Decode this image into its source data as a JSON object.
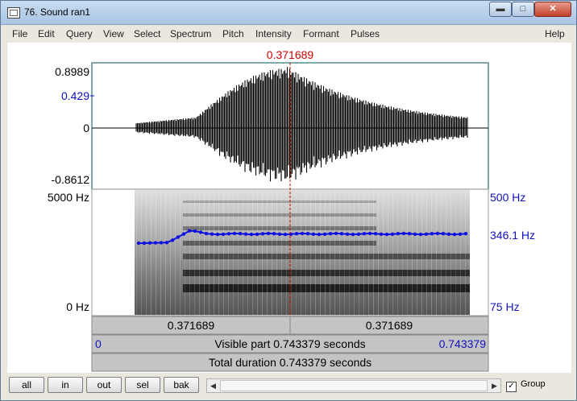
{
  "window": {
    "title": "76. Sound ran1"
  },
  "menu": [
    "File",
    "Edit",
    "Query",
    "View",
    "Select",
    "Spectrum",
    "Pitch",
    "Intensity",
    "Formant",
    "Pulses",
    "Help"
  ],
  "cursor": {
    "time_label": "0.371689",
    "color": "#d00000"
  },
  "waveform": {
    "max_label": "0.8989",
    "cursor_label": "0.429",
    "zero_label": "0",
    "min_label": "-0.8612"
  },
  "spectrogram": {
    "top_label": "5000 Hz",
    "bottom_label": "0 Hz"
  },
  "pitch": {
    "top_label": "500 Hz",
    "value_label": "346.1 Hz",
    "bottom_label": "75 Hz",
    "color": "#1010e0"
  },
  "bars": {
    "left_time": "0.371689",
    "right_time": "0.371689",
    "visible_start": "0",
    "visible_text": "Visible part 0.743379 seconds",
    "visible_end": "0.743379",
    "total_text": "Total duration 0.743379 seconds"
  },
  "toolbar": {
    "buttons": [
      "all",
      "in",
      "out",
      "sel",
      "bak"
    ],
    "group_label": "Group",
    "group_checked": "✓"
  }
}
